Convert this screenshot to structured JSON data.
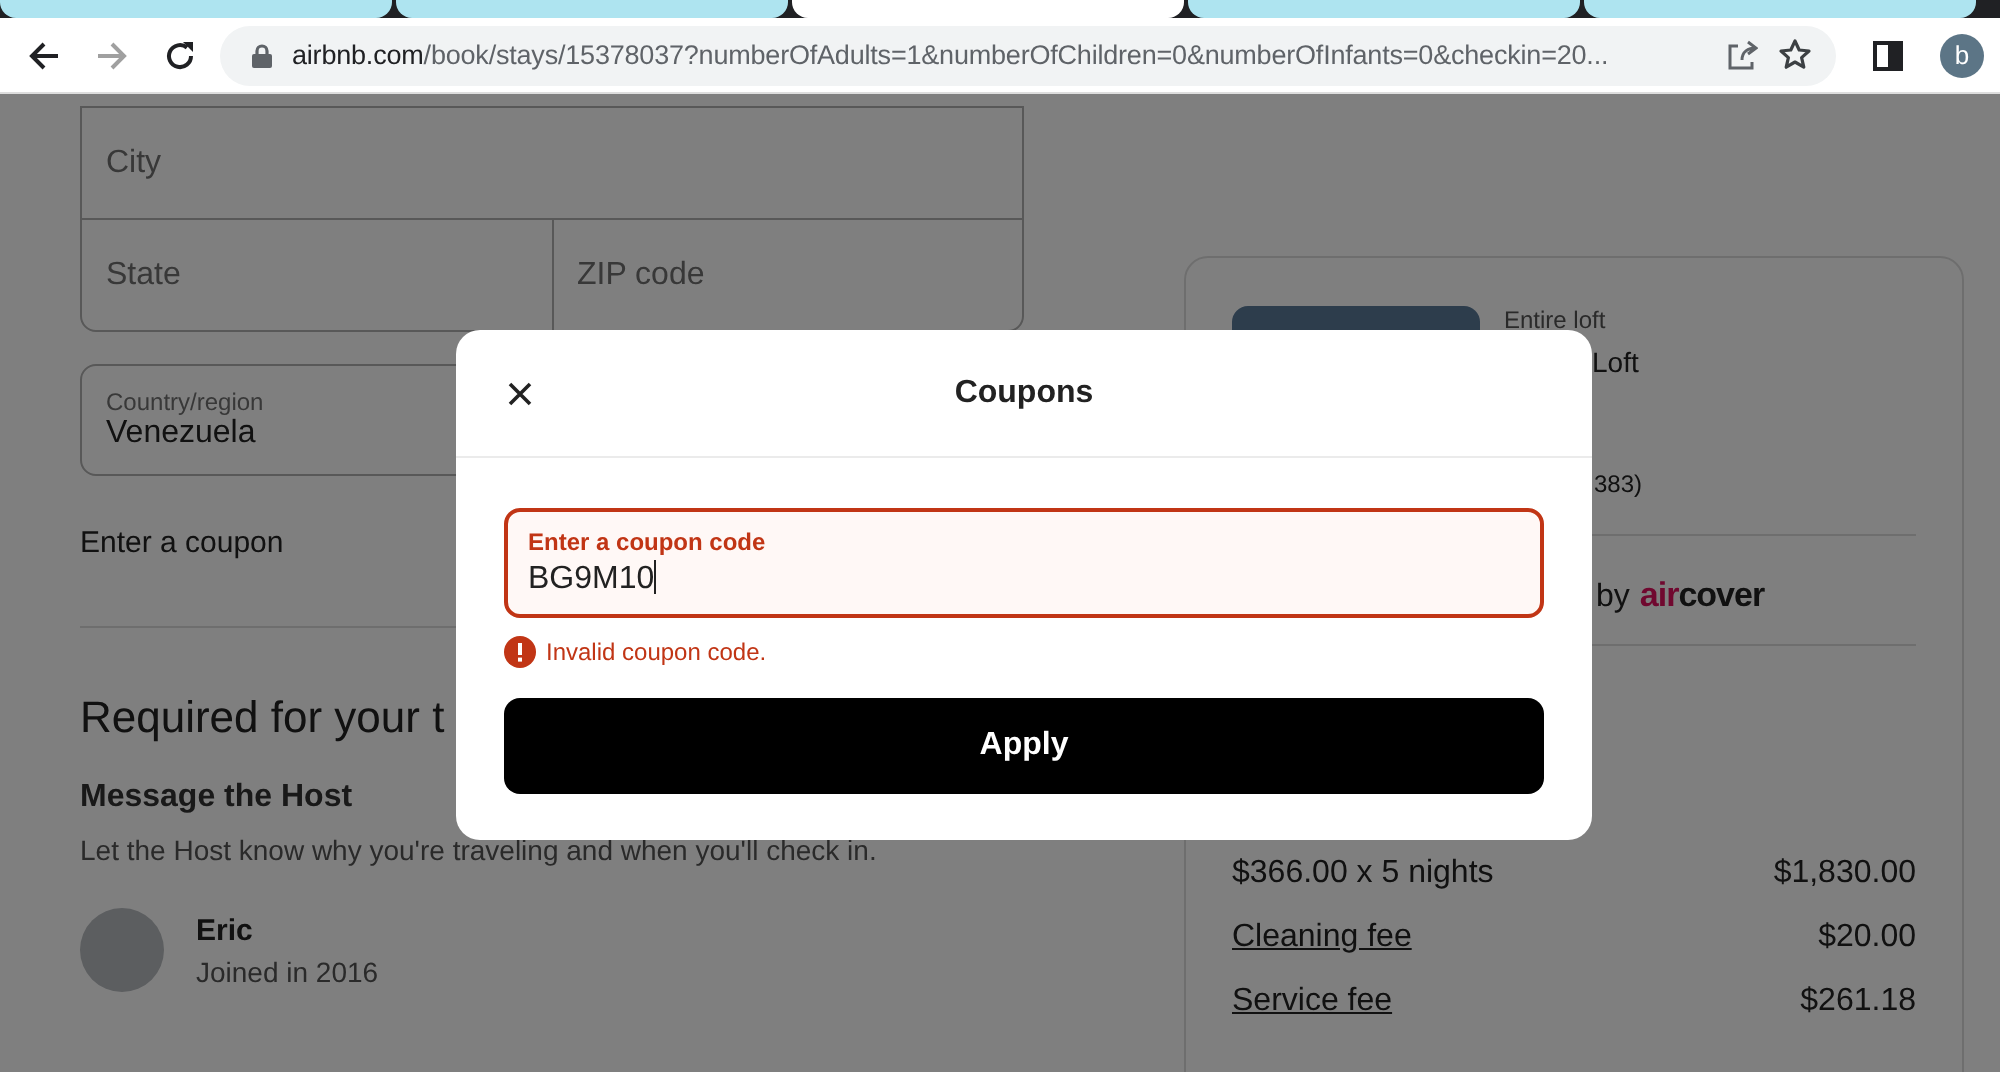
{
  "browser": {
    "tabs": [
      {
        "selected": false
      },
      {
        "selected": false
      },
      {
        "selected": true
      },
      {
        "selected": false
      },
      {
        "selected": false
      }
    ],
    "back_disabled": false,
    "forward_disabled": true,
    "url_host": "airbnb.com",
    "url_path": "/book/stays/15378037?numberOfAdults=1&numberOfChildren=0&numberOfInfants=0&checkin=20...",
    "profile_initial": "b"
  },
  "address_form": {
    "fields": [
      {
        "label": "City"
      },
      {
        "label": "State"
      },
      {
        "label": "ZIP code"
      }
    ],
    "country": {
      "label": "Country/region",
      "value": "Venezuela"
    }
  },
  "coupon_link": "Enter a coupon",
  "required_heading": "Required for your t",
  "message_host": {
    "title": "Message the Host",
    "subtitle": "Let the Host know why you're traveling and when you'll check in."
  },
  "host": {
    "name": "Eric",
    "joined": "Joined in 2016"
  },
  "listing_card": {
    "type": "Entire loft",
    "title_fragment": "Loft",
    "reviews_fragment": "383)",
    "protection_fragment": "by",
    "logo": {
      "part1": "air",
      "part2": "cover"
    },
    "price_rows": [
      {
        "label": "$366.00 x 5 nights",
        "amount": "$1,830.00",
        "link": false
      },
      {
        "label": "Cleaning fee",
        "amount": "$20.00",
        "link": true
      },
      {
        "label": "Service fee",
        "amount": "$261.18",
        "link": true
      }
    ]
  },
  "modal": {
    "title": "Coupons",
    "field": {
      "label": "Enter a coupon code",
      "value": "BG9M10",
      "invalid": true
    },
    "error": "Invalid coupon code.",
    "apply_button": "Apply"
  }
}
